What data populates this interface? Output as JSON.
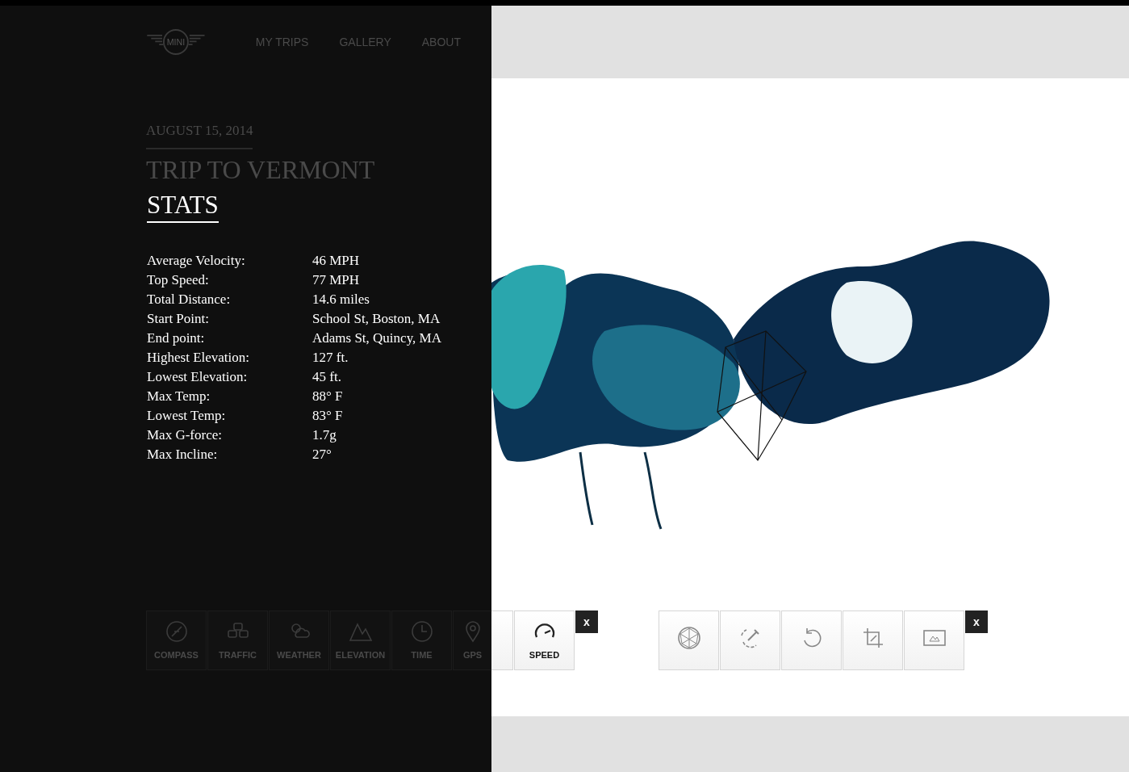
{
  "nav": {
    "logo": "MINI",
    "links": [
      {
        "label": "MY TRIPS"
      },
      {
        "label": "GALLERY"
      },
      {
        "label": "ABOUT"
      }
    ]
  },
  "trip": {
    "date": "AUGUST 15, 2014",
    "title": "TRIP TO VERMONT"
  },
  "stats": {
    "heading": "STATS",
    "rows": [
      {
        "label": "Average Velocity:",
        "value": "46 MPH"
      },
      {
        "label": "Top Speed:",
        "value": "77 MPH"
      },
      {
        "label": "Total Distance:",
        "value": "14.6 miles"
      },
      {
        "label": "Start Point:",
        "value": "School St, Boston, MA"
      },
      {
        "label": "End point:",
        "value": "Adams St, Quincy, MA"
      },
      {
        "label": "Highest Elevation:",
        "value": "127 ft."
      },
      {
        "label": "Lowest Elevation:",
        "value": "45 ft."
      },
      {
        "label": "Max Temp:",
        "value": "88° F"
      },
      {
        "label": "Lowest Temp:",
        "value": "83° F"
      },
      {
        "label": "Max G-force:",
        "value": "1.7g"
      },
      {
        "label": "Max Incline:",
        "value": "27°"
      }
    ]
  },
  "data_toolbar": {
    "buttons": [
      {
        "kind": "compass",
        "label": "COMPASS"
      },
      {
        "kind": "traffic",
        "label": "TRAFFIC"
      },
      {
        "kind": "weather",
        "label": "WEATHER"
      },
      {
        "kind": "elevation",
        "label": "ELEVATION"
      },
      {
        "kind": "time",
        "label": "TIME"
      },
      {
        "kind": "gps",
        "label": "GPS"
      },
      {
        "kind": "speed",
        "label": "SPEED"
      }
    ],
    "close": "x"
  },
  "edit_toolbar": {
    "buttons": [
      {
        "kind": "geodesic"
      },
      {
        "kind": "color"
      },
      {
        "kind": "undo"
      },
      {
        "kind": "crop"
      },
      {
        "kind": "image"
      }
    ],
    "close": "x"
  }
}
